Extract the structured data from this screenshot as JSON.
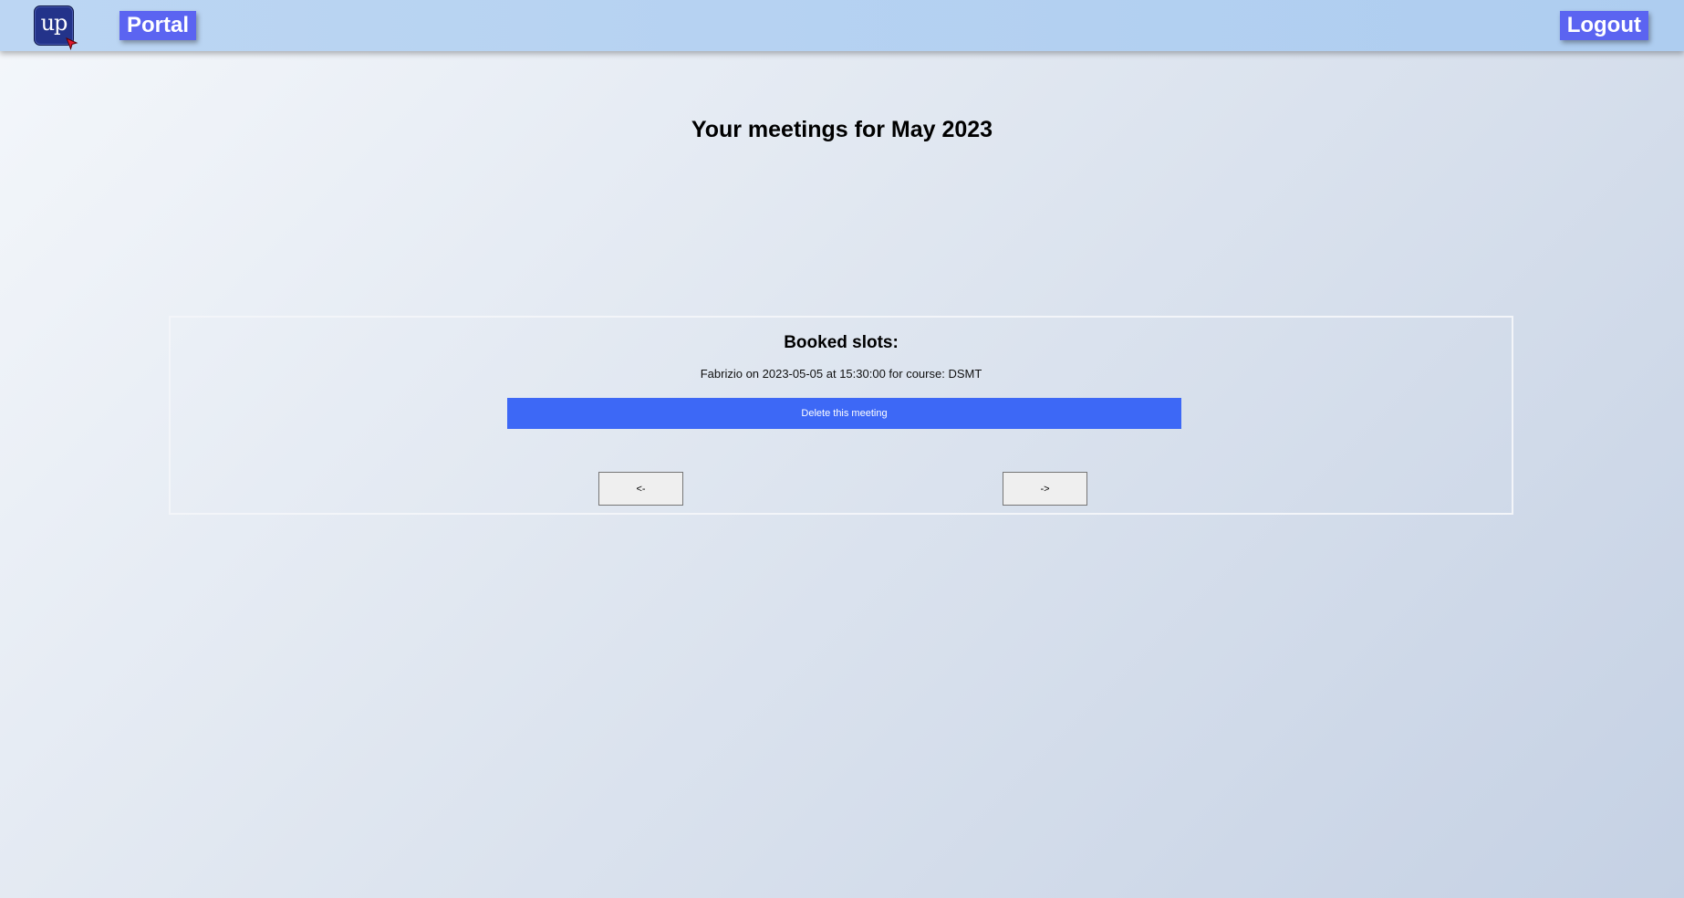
{
  "header": {
    "logo_text": "up",
    "portal_label": "Portal",
    "logout_label": "Logout"
  },
  "main": {
    "title": "Your meetings for May 2023",
    "booked": {
      "heading": "Booked slots:",
      "slots": [
        {
          "description": "Fabrizio on 2023-05-05 at 15:30:00 for course: DSMT",
          "delete_label": "Delete this meeting"
        }
      ]
    },
    "pagination": {
      "prev_label": "<-",
      "next_label": "->"
    }
  },
  "colors": {
    "topbar": "#b4d1f1",
    "nav_button": "#5b64f1",
    "delete_button": "#3d68f6",
    "logo_bg": "#23338a"
  }
}
